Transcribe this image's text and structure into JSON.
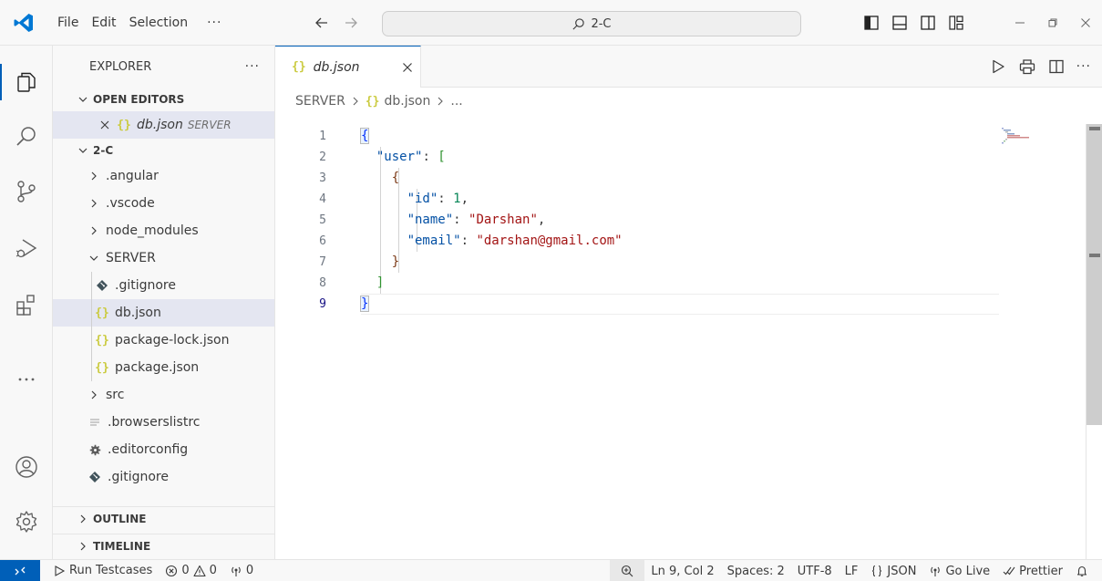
{
  "titlebar": {
    "menu": [
      "File",
      "Edit",
      "Selection"
    ],
    "more": "···",
    "search_text": "2-C"
  },
  "sidebar": {
    "title": "EXPLORER",
    "more": "···",
    "open_editors_label": "OPEN EDITORS",
    "open_editor": {
      "name": "db.json",
      "description": "SERVER"
    },
    "folder_label": "2-C",
    "tree": [
      {
        "label": ".angular",
        "kind": "folder"
      },
      {
        "label": ".vscode",
        "kind": "folder"
      },
      {
        "label": "node_modules",
        "kind": "folder"
      },
      {
        "label": "SERVER",
        "kind": "folder-open"
      },
      {
        "label": ".gitignore",
        "kind": "git"
      },
      {
        "label": "db.json",
        "kind": "json"
      },
      {
        "label": "package-lock.json",
        "kind": "json"
      },
      {
        "label": "package.json",
        "kind": "json"
      },
      {
        "label": "src",
        "kind": "folder"
      },
      {
        "label": ".browserslistrc",
        "kind": "text"
      },
      {
        "label": ".editorconfig",
        "kind": "gear"
      },
      {
        "label": ".gitignore",
        "kind": "git"
      }
    ],
    "outline_label": "OUTLINE",
    "timeline_label": "TIMELINE"
  },
  "editor": {
    "tab_label": "db.json",
    "breadcrumbs": [
      "SERVER",
      "db.json",
      "..."
    ],
    "line_numbers": [
      "1",
      "2",
      "3",
      "4",
      "5",
      "6",
      "7",
      "8",
      "9"
    ],
    "code": {
      "l1_brace": "{",
      "l2_key": "\"user\"",
      "l2_colon": ": ",
      "l2_bracket": "[",
      "l3_brace": "{",
      "l4_key": "\"id\"",
      "l4_colon": ": ",
      "l4_value": "1",
      "l4_comma": ",",
      "l5_key": "\"name\"",
      "l5_colon": ": ",
      "l5_value": "\"Darshan\"",
      "l5_comma": ",",
      "l6_key": "\"email\"",
      "l6_colon": ": ",
      "l6_value": "\"darshan@gmail.com\"",
      "l7_brace": "}",
      "l8_bracket": "]",
      "l9_brace": "}"
    },
    "actions_more": "···"
  },
  "statusbar": {
    "run_testcases": "Run Testcases",
    "errors": "0",
    "warnings": "0",
    "ports": "0",
    "position": "Ln 9, Col 2",
    "spaces": "Spaces: 2",
    "encoding": "UTF-8",
    "eol": "LF",
    "language": "JSON",
    "go_live": "Go Live",
    "prettier": "Prettier"
  },
  "colors": {
    "accent": "#005fb8",
    "json_icon": "#cbcb41",
    "string": "#a31515",
    "key": "#0451a5",
    "number": "#098658"
  }
}
